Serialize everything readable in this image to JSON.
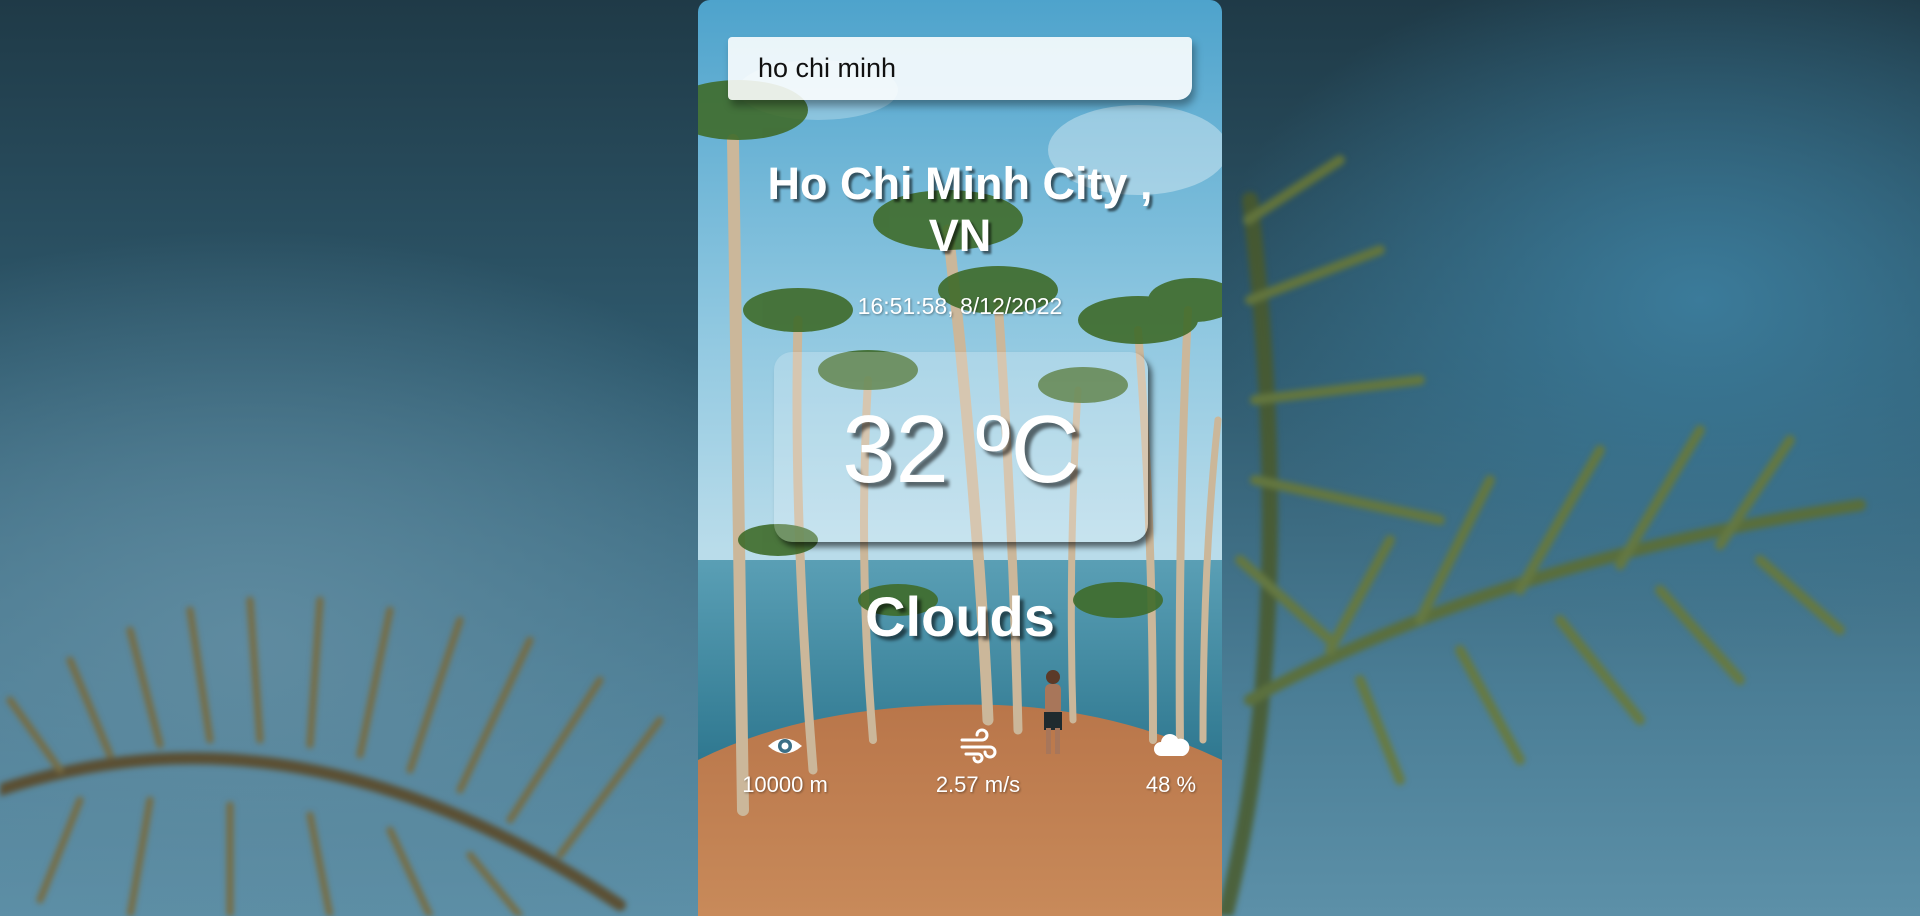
{
  "search": {
    "value": "ho chi minh",
    "placeholder": ""
  },
  "location": {
    "city_line": "Ho Chi Minh City ,",
    "country_line": "VN"
  },
  "datetime": "16:51:58, 8/12/2022",
  "temperature": "32 ºC",
  "condition": "Clouds",
  "stats": [
    {
      "icon": "eye-icon",
      "value": "10000 m"
    },
    {
      "icon": "wind-icon",
      "value": "2.57 m/s"
    },
    {
      "icon": "cloud-icon",
      "value": "48 %"
    }
  ]
}
